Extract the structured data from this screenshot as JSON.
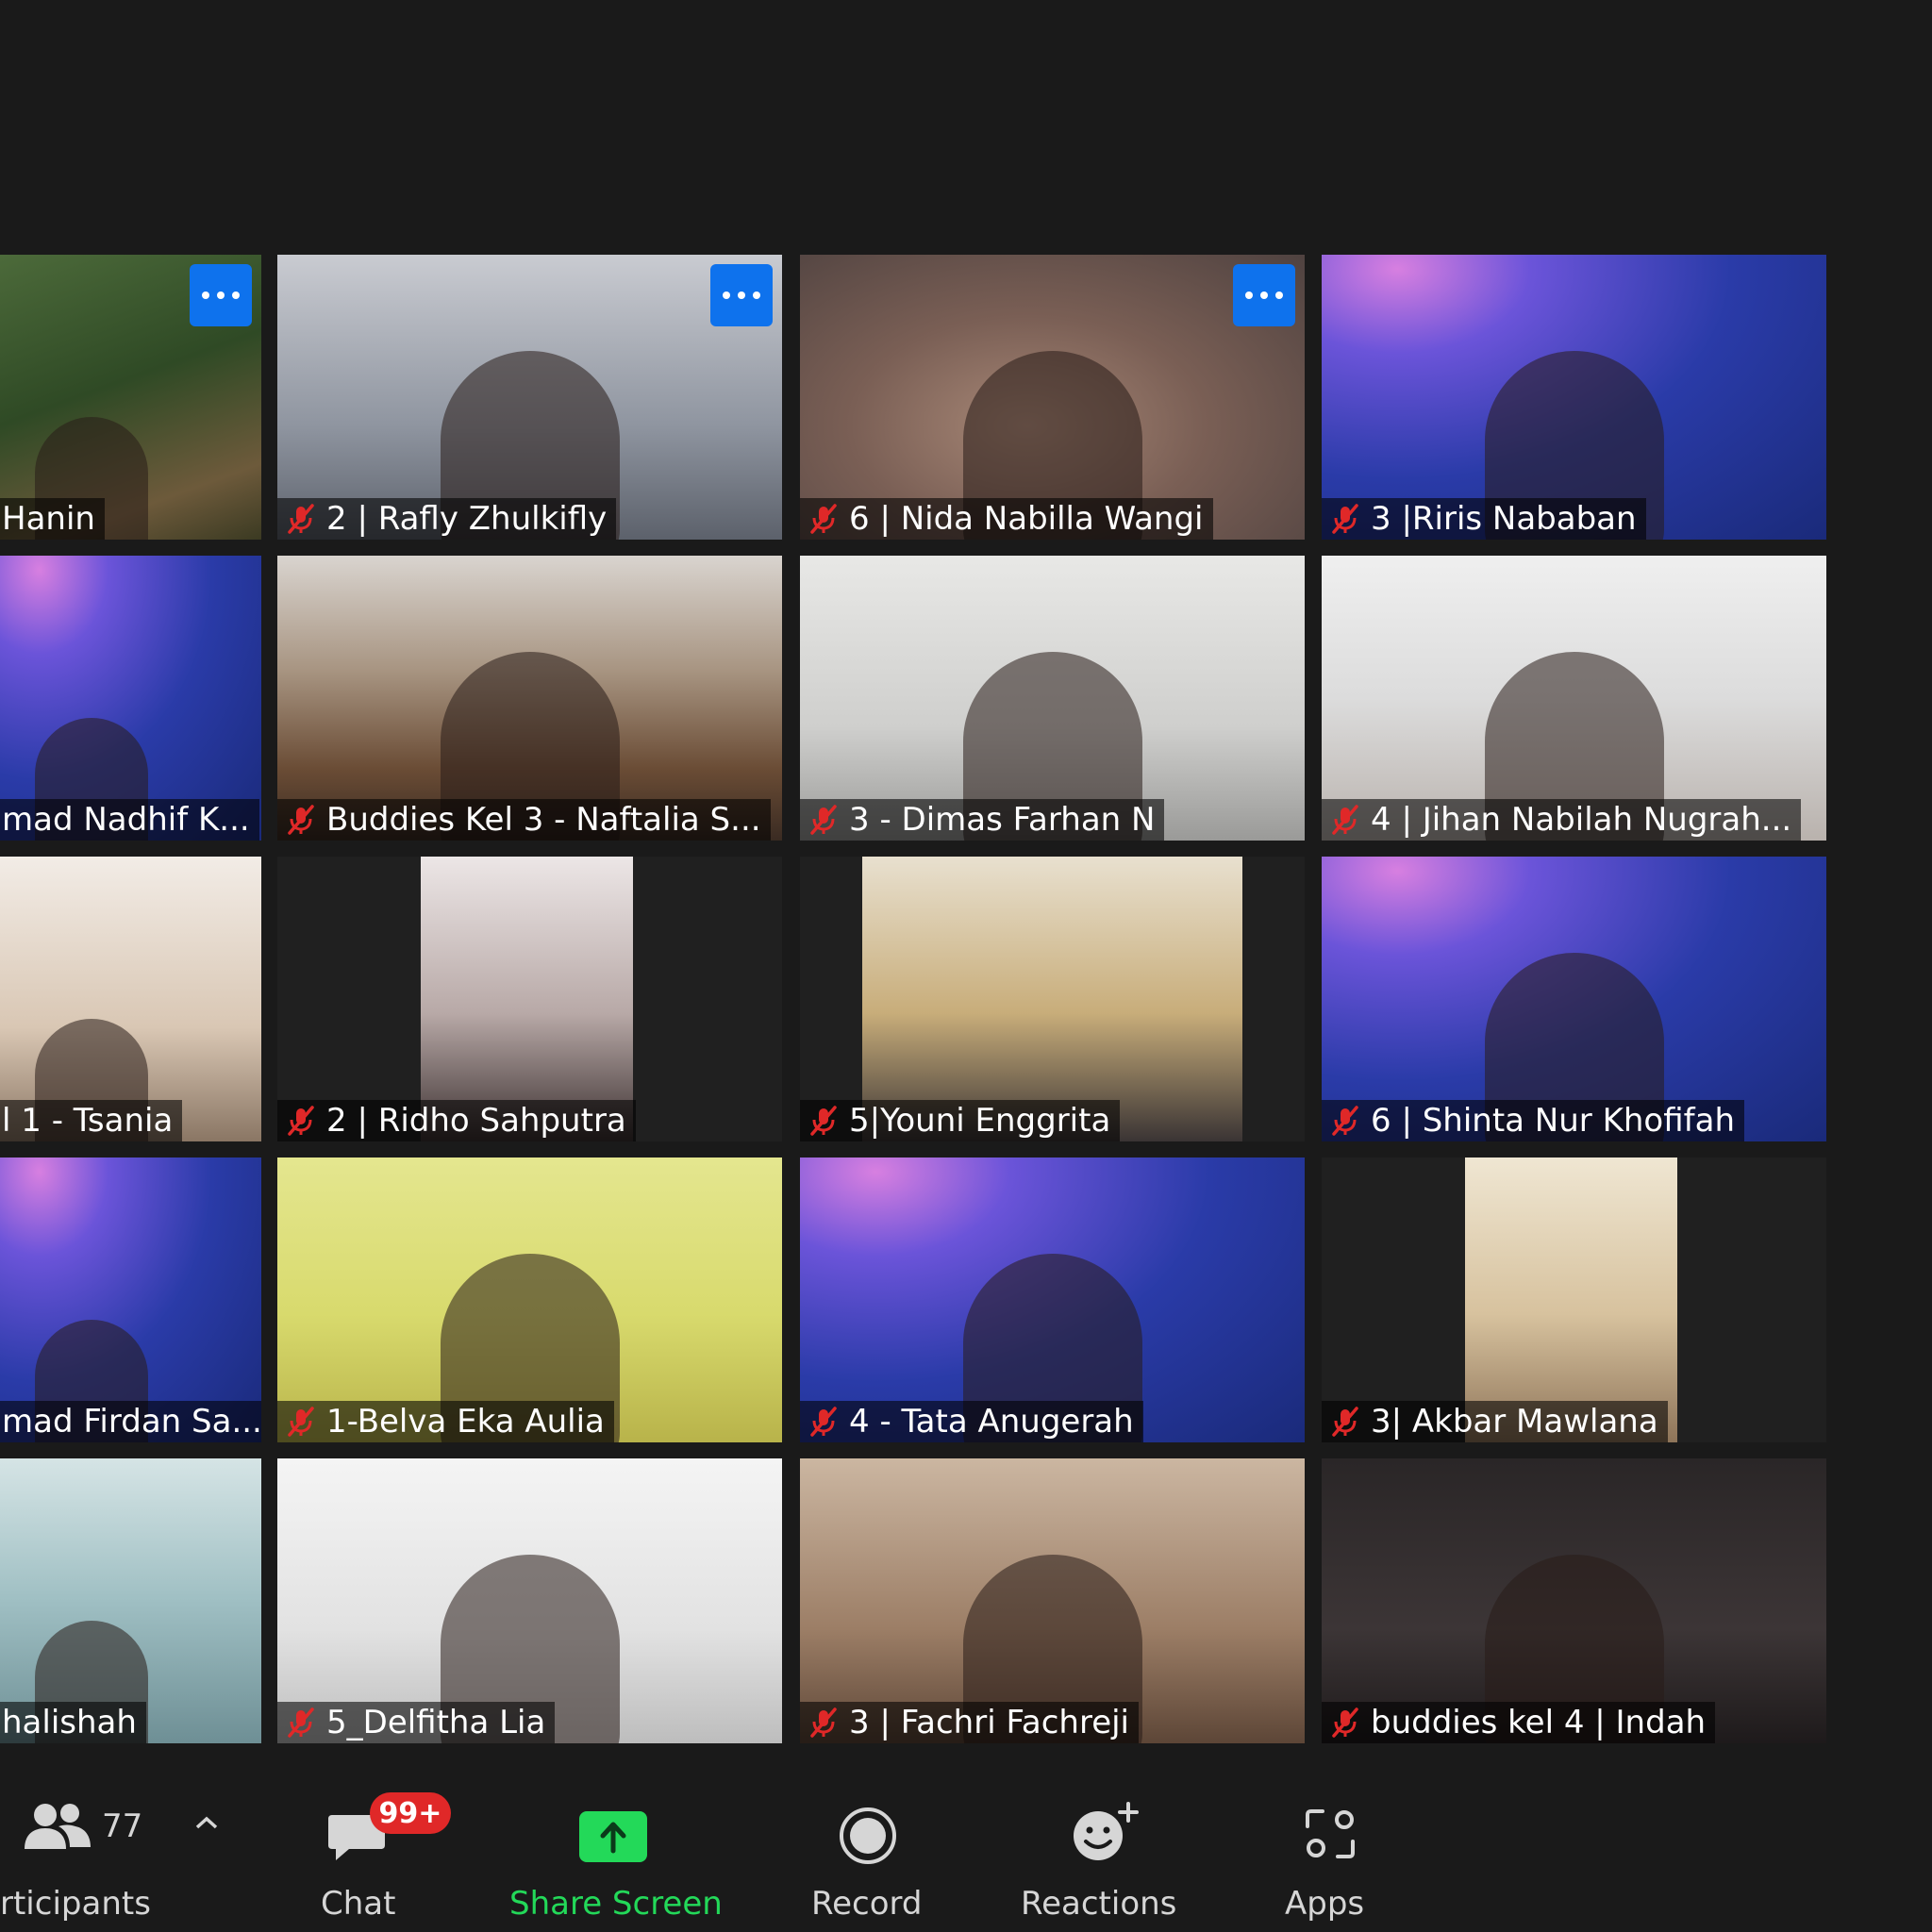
{
  "gallery": {
    "tiles": [
      {
        "name": "Hanin",
        "muted": false
      },
      {
        "name": "2 | Rafly Zhulkifly",
        "muted": true
      },
      {
        "name": "6 | Nida Nabilla Wangi",
        "muted": true
      },
      {
        "name": "3 |Riris Nababan",
        "muted": true
      },
      {
        "name": "mad Nadhif K...",
        "muted": false
      },
      {
        "name": "Buddies Kel 3 - Naftalia S...",
        "muted": true
      },
      {
        "name": "3 - Dimas Farhan N",
        "muted": true
      },
      {
        "name": "4 | Jihan Nabilah Nugrah...",
        "muted": true
      },
      {
        "name": "l 1 - Tsania",
        "muted": false
      },
      {
        "name": "2 | Ridho Sahputra",
        "muted": true
      },
      {
        "name": "5|Youni Enggrita",
        "muted": true
      },
      {
        "name": "6 | Shinta Nur Khofifah",
        "muted": true
      },
      {
        "name": "mad Firdan Sa...",
        "muted": false
      },
      {
        "name": "1-Belva Eka Aulia",
        "muted": true
      },
      {
        "name": "4 - Tata Anugerah",
        "muted": true
      },
      {
        "name": "3| Akbar Mawlana",
        "muted": true
      },
      {
        "name": "halishah",
        "muted": false
      },
      {
        "name": "5_Delfitha Lia",
        "muted": true
      },
      {
        "name": "3 | Fachri Fachreji",
        "muted": true
      },
      {
        "name": "buddies kel 4 | Indah",
        "muted": true
      }
    ]
  },
  "toolbar": {
    "participants": {
      "label": "rticipants",
      "count": "77"
    },
    "chat": {
      "label": "Chat",
      "badge": "99+"
    },
    "share": {
      "label": "Share Screen"
    },
    "record": {
      "label": "Record"
    },
    "reactions": {
      "label": "Reactions"
    },
    "apps": {
      "label": "Apps"
    }
  },
  "colors": {
    "accent_blue": "#0e72ed",
    "share_green": "#23d959",
    "mute_red": "#e02828",
    "badge_red": "#e02828"
  }
}
